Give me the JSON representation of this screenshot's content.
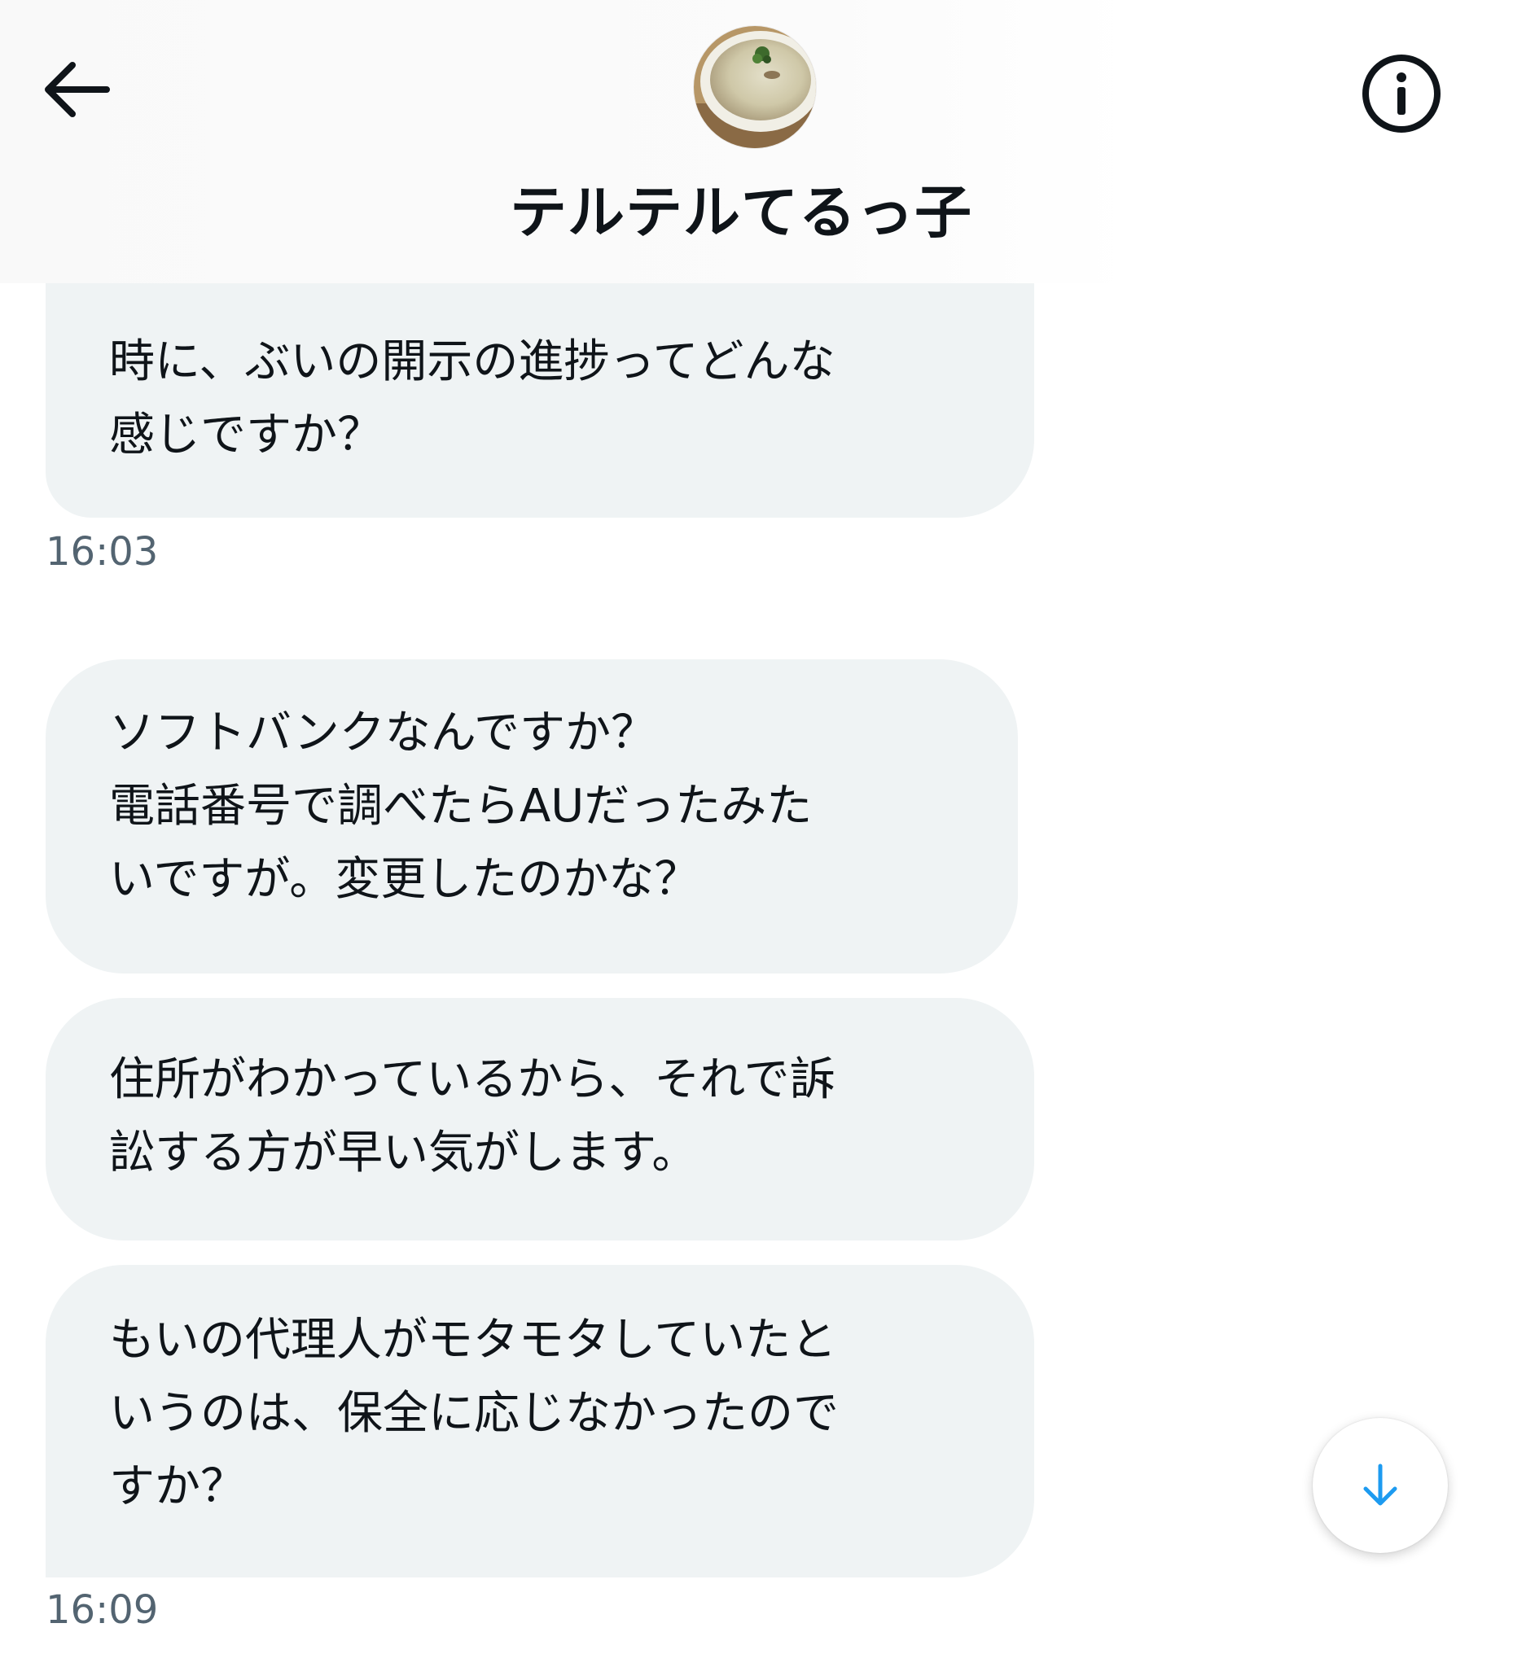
{
  "header": {
    "title": "テルテルてるっ子",
    "back_icon": "arrow-left-icon",
    "info_icon": "info-circle-icon"
  },
  "messages": [
    {
      "lines": [
        "時に、ぶいの開示の進捗ってどんな",
        "感じですか？"
      ],
      "time": "16:03"
    },
    {
      "lines": [
        "ソフトバンクなんですか？",
        "電話番号で調べたらAUだったみた",
        "いですが。変更したのかな？"
      ]
    },
    {
      "lines": [
        "住所がわかっているから、それで訴",
        "訟する方が早い気がします。"
      ]
    },
    {
      "lines": [
        "もいの代理人がモタモタしていたと",
        "いうのは、保全に応じなかったので",
        "すか？"
      ],
      "time": "16:09"
    }
  ],
  "scroll_button": {
    "icon": "arrow-down-icon"
  },
  "colors": {
    "bubble": "#eff3f4",
    "text": "#0f1419",
    "timestamp": "#536471",
    "accent": "#1d9bf0"
  }
}
